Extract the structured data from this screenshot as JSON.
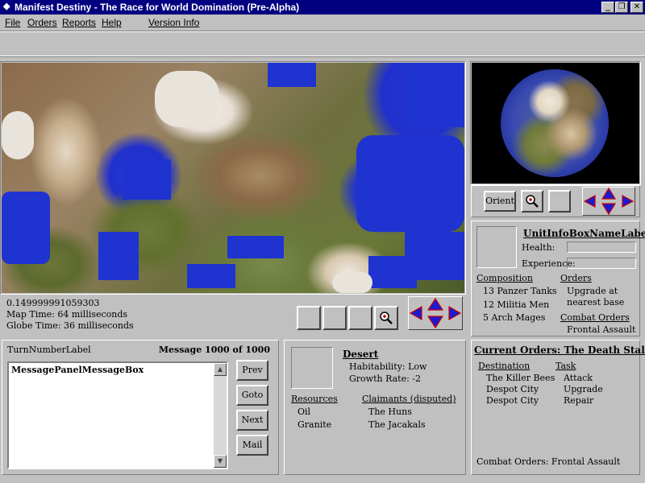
{
  "window": {
    "title": "Manifest Destiny - The Race for World Domination  (Pre-Alpha)",
    "controls": {
      "minimize": "_",
      "maximize": "❐",
      "close": "✕"
    }
  },
  "menu": {
    "file": "File",
    "orders": "Orders",
    "reports": "Reports",
    "help": "Help",
    "version_info": "Version Info"
  },
  "map_status": {
    "value": "0.149999991059303",
    "map_time": "Map Time: 64 milliseconds",
    "globe_time": "Globe Time: 36 milliseconds"
  },
  "globe_controls": {
    "orient": "Orient"
  },
  "unit_info": {
    "name": "UnitInfoBoxNameLabel",
    "health_label": "Health:",
    "experience_label": "Experience:",
    "composition_header": "Composition",
    "composition": [
      "13 Panzer Tanks",
      "12 Militia Men",
      "5 Arch Mages"
    ],
    "orders_header": "Orders",
    "orders_value_line1": "Upgrade at",
    "orders_value_line2": "nearest base",
    "combat_orders_header": "Combat Orders",
    "combat_orders_value": "Frontal Assault"
  },
  "messages": {
    "turn_label": "TurnNumberLabel",
    "counter": "Message 1000 of 1000",
    "box_text": "MessagePanelMessageBox",
    "buttons": {
      "prev": "Prev",
      "goto": "Goto",
      "next": "Next",
      "mail": "Mail"
    }
  },
  "tile": {
    "terrain": "Desert",
    "habitability": "Habitability: Low",
    "growth_rate": "Growth Rate: -2",
    "resources_header": "Resources",
    "resources": [
      "Oil",
      "Granite"
    ],
    "claimants_header": "Claimants (disputed)",
    "claimants": [
      "The Huns",
      "The Jacakals"
    ]
  },
  "current_orders": {
    "title": "Current Orders: The Death Stalkers",
    "destination_header": "Destination",
    "task_header": "Task",
    "rows": [
      {
        "destination": "The Killer Bees",
        "task": "Attack"
      },
      {
        "destination": "Despot City",
        "task": "Upgrade"
      },
      {
        "destination": "Despot City",
        "task": "Repair"
      }
    ],
    "combat_orders": "Combat Orders: Frontal Assault"
  },
  "colors": {
    "title_bar": "#000080",
    "face": "#c0c0c0",
    "arrow_fill": "#1a1ad0",
    "arrow_outline": "#d00000",
    "ocean": "#1f33d0"
  },
  "icons": [
    "magnifier-icon",
    "arrow-left-icon",
    "arrow-up-icon",
    "arrow-down-icon",
    "arrow-right-icon"
  ]
}
